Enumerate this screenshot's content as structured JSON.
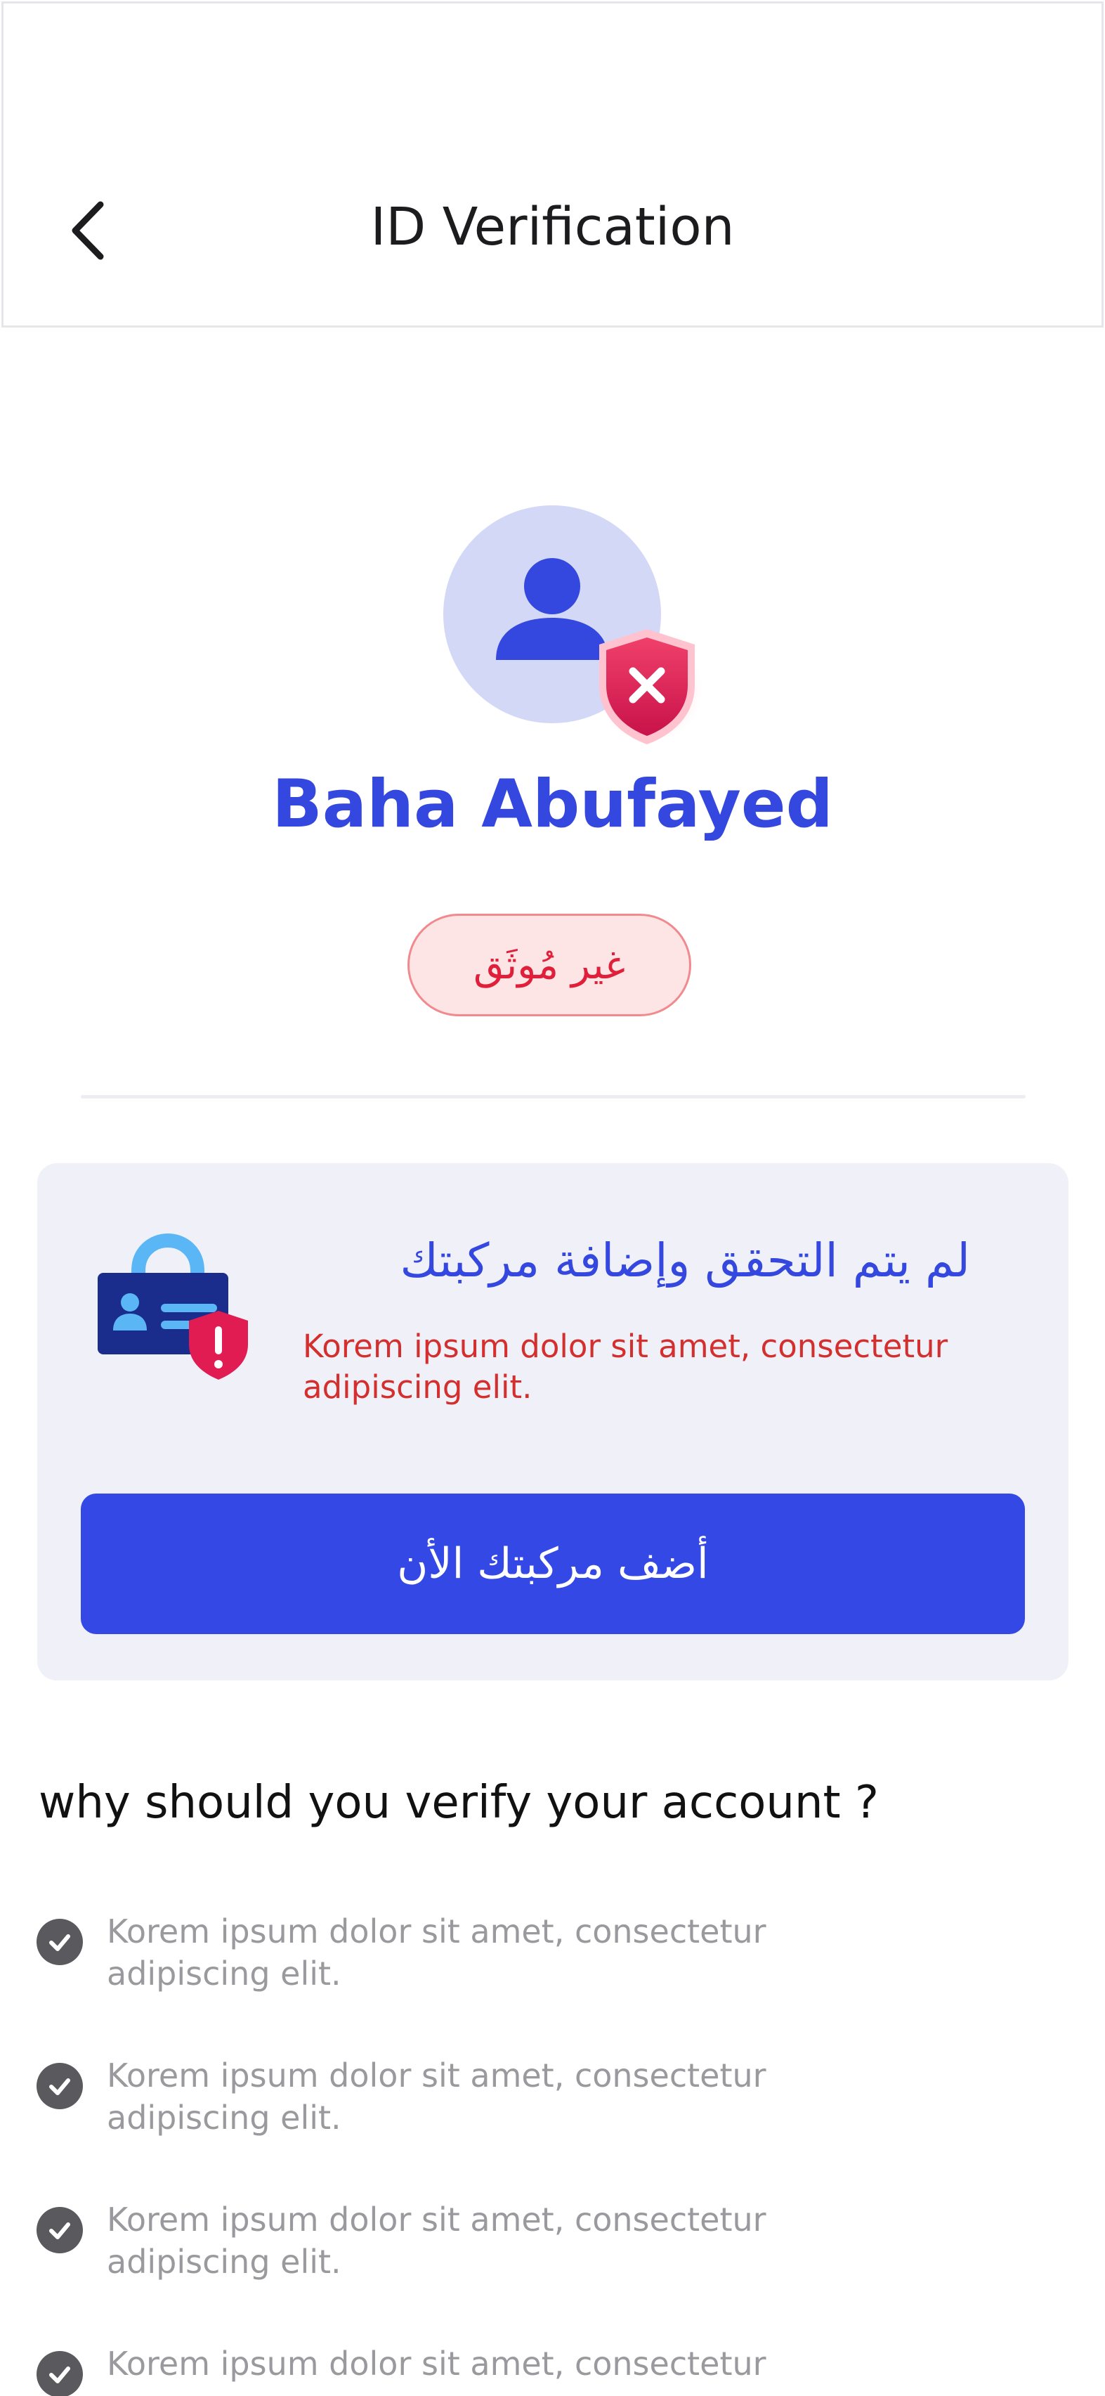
{
  "header": {
    "title": "ID Verification",
    "back_icon": "chevron-left-icon"
  },
  "profile": {
    "name": "Baha Abufayed",
    "status_badge": "غير مُوثَق",
    "avatar_icon": "user-icon",
    "badge_icon": "shield-x-icon"
  },
  "warning_card": {
    "title": "لم يتم التحقق وإضافة مركبتك",
    "description": "Korem ipsum dolor sit amet, consectetur adipiscing elit.",
    "illustration_icon": "id-card-lock-icon",
    "button_label": "أضف مركبتك الأن"
  },
  "why_section": {
    "title": "why should you verify your account ?",
    "items": [
      {
        "text": "Korem ipsum dolor sit amet, consectetur adipiscing elit."
      },
      {
        "text": "Korem ipsum dolor sit amet, consectetur adipiscing elit."
      },
      {
        "text": "Korem ipsum dolor sit amet, consectetur adipiscing elit."
      },
      {
        "text": "Korem ipsum dolor sit amet, consectetur"
      }
    ]
  },
  "colors": {
    "primary": "#3448df",
    "danger": "#e0203a",
    "card_bg": "#f0f0f8"
  }
}
